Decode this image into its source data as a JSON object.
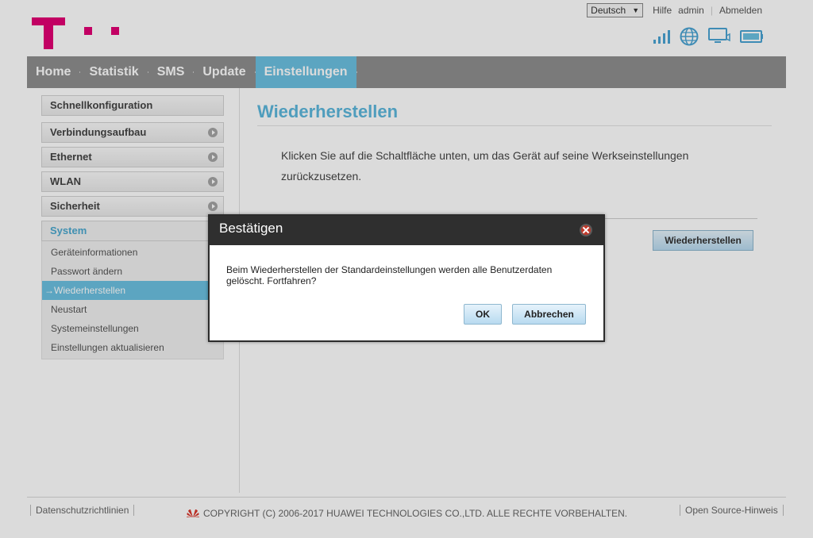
{
  "header": {
    "language": "Deutsch",
    "help": "Hilfe",
    "user": "admin",
    "logout": "Abmelden"
  },
  "nav": {
    "items": [
      {
        "label": "Home"
      },
      {
        "label": "Statistik"
      },
      {
        "label": "SMS"
      },
      {
        "label": "Update"
      },
      {
        "label": "Einstellungen"
      }
    ]
  },
  "sidebar": {
    "quick": "Schnellkonfiguration",
    "items": [
      {
        "label": "Verbindungsaufbau"
      },
      {
        "label": "Ethernet"
      },
      {
        "label": "WLAN"
      },
      {
        "label": "Sicherheit"
      }
    ],
    "system": {
      "label": "System",
      "sub": [
        {
          "label": "Geräteinformationen"
        },
        {
          "label": "Passwort ändern"
        },
        {
          "label": "Wiederherstellen"
        },
        {
          "label": "Neustart"
        },
        {
          "label": "Systemeinstellungen"
        },
        {
          "label": "Einstellungen aktualisieren"
        }
      ]
    }
  },
  "main": {
    "title": "Wiederherstellen",
    "description": "Klicken Sie auf die Schaltfläche unten, um das Gerät auf seine Werkseinstellungen zurückzusetzen.",
    "button": "Wiederherstellen"
  },
  "footer": {
    "privacy": "Datenschutzrichtlinien",
    "copyright": "COPYRIGHT (C) 2006-2017 HUAWEI TECHNOLOGIES CO.,LTD. ALLE RECHTE VORBEHALTEN.",
    "opensource": "Open Source-Hinweis"
  },
  "dialog": {
    "title": "Bestätigen",
    "message": "Beim Wiederherstellen der Standardeinstellungen werden alle Benutzerdaten gelöscht. Fortfahren?",
    "ok": "OK",
    "cancel": "Abbrechen"
  },
  "colors": {
    "brand": "#e20074",
    "accent": "#6cc1e1",
    "nav_bg": "#8f8f8f",
    "title": "#5cb7dc"
  },
  "icons": [
    "signal-icon",
    "globe-icon",
    "monitor-icon",
    "battery-icon",
    "close-icon",
    "chevron-right-icon",
    "huawei-logo-icon"
  ]
}
